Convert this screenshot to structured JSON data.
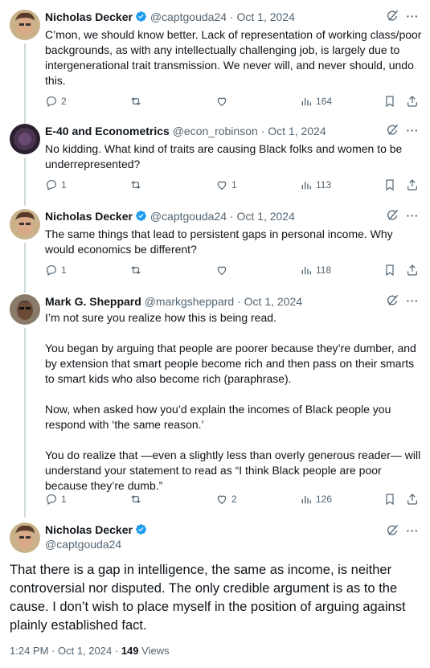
{
  "tweets": [
    {
      "name": "Nicholas Decker",
      "handle": "@captgouda24",
      "sep": "·",
      "date": "Oct 1, 2024",
      "verified": true,
      "text": [
        "C’mon, we should know better. Lack of representation of working class/poor backgrounds, as with any intellectually challenging job, is largely due to intergenerational trait transmission. We never will, and never should, undo this."
      ],
      "replies": "2",
      "reposts": "",
      "likes": "",
      "views": "164"
    },
    {
      "name": "E-40 and Econometrics",
      "handle": "@econ_robinson",
      "sep": "·",
      "date": "Oct 1, 2024",
      "verified": false,
      "text": [
        "No kidding. What kind of traits are causing Black folks and women to be underrepresented?"
      ],
      "replies": "1",
      "reposts": "",
      "likes": "1",
      "views": "113"
    },
    {
      "name": "Nicholas Decker",
      "handle": "@captgouda24",
      "sep": "·",
      "date": "Oct 1, 2024",
      "verified": true,
      "text": [
        "The same things that lead to persistent gaps in personal income. Why would economics be different?"
      ],
      "replies": "1",
      "reposts": "",
      "likes": "",
      "views": "118"
    },
    {
      "name": "Mark G. Sheppard",
      "handle": "@markgsheppard",
      "sep": "·",
      "date": "Oct 1, 2024",
      "verified": false,
      "text": [
        "I’m not sure you realize how this is being read.",
        "You began by arguing that people are poorer because they’re dumber, and by extension that smart people become rich and then pass on their smarts to smart kids who also become rich (paraphrase).",
        "Now, when asked how you’d explain the incomes of Black people you respond with ‘the same reason.’",
        "You do realize that —even a slightly less than overly generous reader— will understand your statement to read as “I think Black people are poor because they’re dumb.”"
      ],
      "replies": "1",
      "reposts": "",
      "likes": "2",
      "views": "126"
    }
  ],
  "main": {
    "name": "Nicholas Decker",
    "handle": "@captgouda24",
    "text": "That there is a gap in intelligence, the same as income, is neither controversial nor disputed. The only credible argument is as to the cause. I don’t wish to place myself in the position of arguing against plainly established fact.",
    "time": "1:24 PM",
    "sep": "·",
    "date": "Oct 1, 2024",
    "views_count": "149",
    "views_label": "Views"
  },
  "icons": {
    "reply": "reply-icon",
    "repost": "repost-icon",
    "like": "like-icon",
    "views": "views-icon",
    "bookmark": "bookmark-icon",
    "share": "share-icon",
    "grok": "grok-icon",
    "more": "more-icon",
    "verified": "verified-badge-icon"
  },
  "colors": {
    "text": "#0f1419",
    "muted": "#536471",
    "verified": "#1d9bf0",
    "thread_line": "#cfd9de"
  }
}
